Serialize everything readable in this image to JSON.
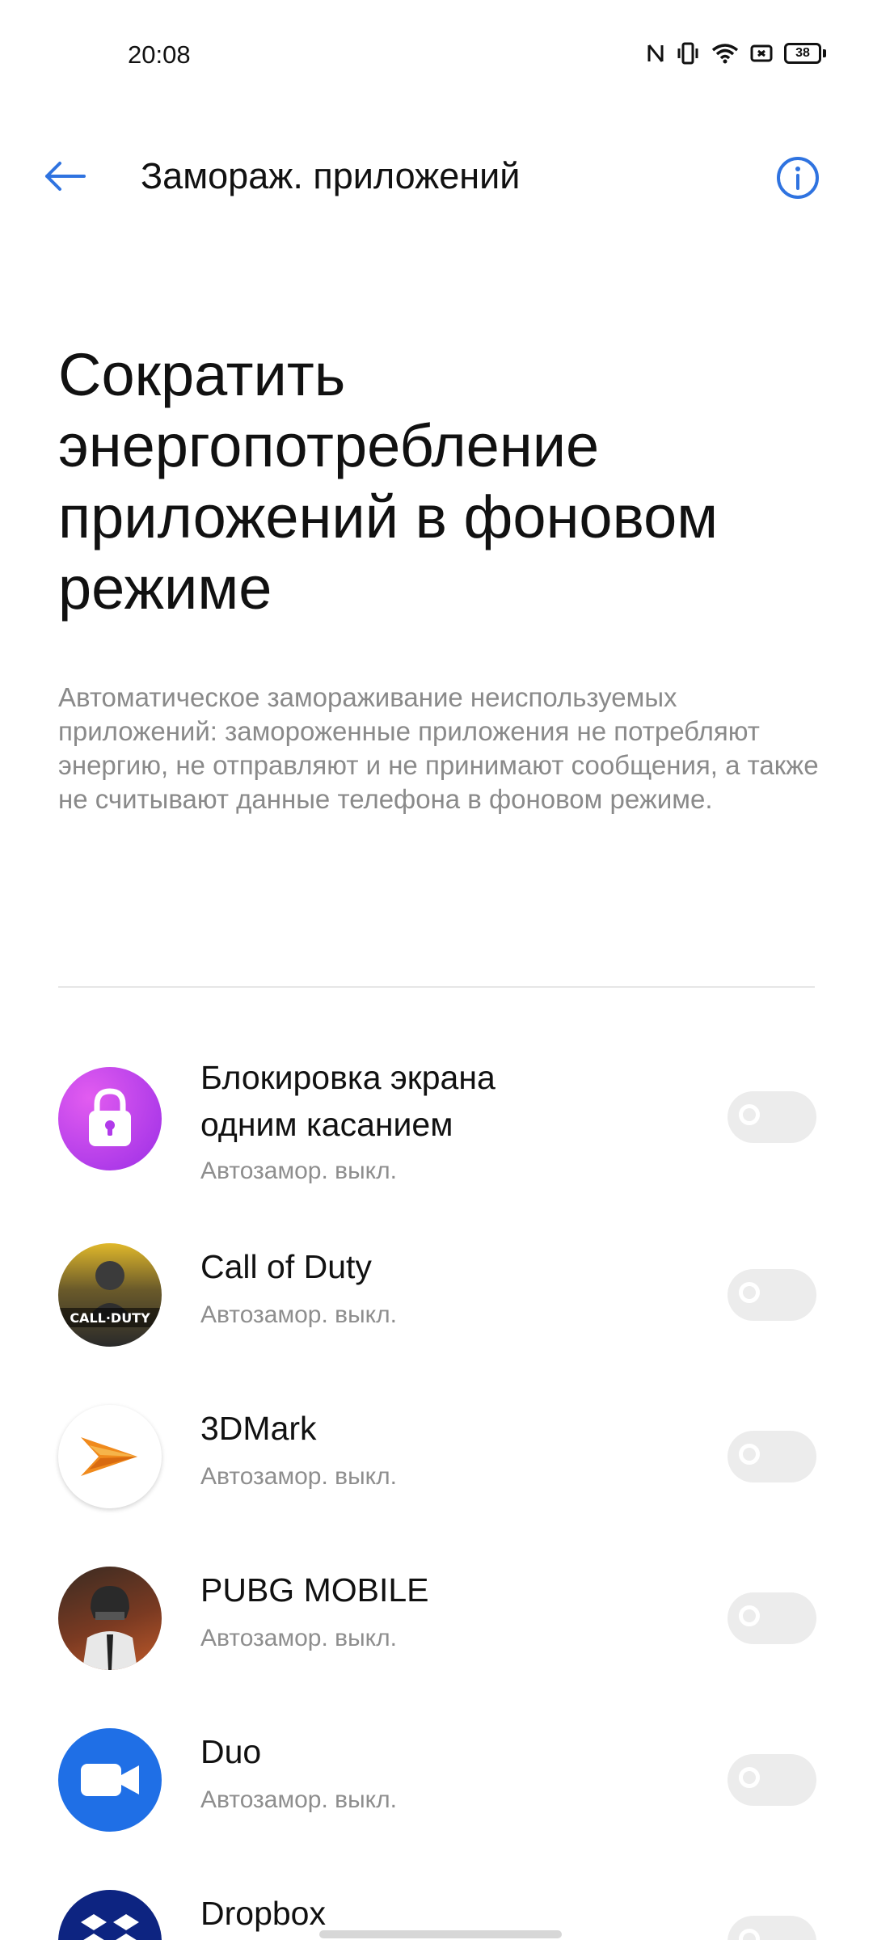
{
  "status_bar": {
    "time": "20:08",
    "battery_level": "38",
    "icons": [
      "nfc-icon",
      "vibrate-icon",
      "wifi-icon",
      "screen-record-icon",
      "battery-icon"
    ]
  },
  "app_bar": {
    "title": "Замораж. приложений",
    "back_icon": "arrow-left-icon",
    "info_icon": "info-icon",
    "accent_color": "#2f73e0"
  },
  "hero": {
    "title": "Сократить энергопотребление приложений в фоновом режиме",
    "description": "Автоматическое замораживание неиспользуемых приложений: замороженные приложения не потребляют энергию, не отправляют и не принимают сообщения, а также не считывают данные телефона в фоновом режиме."
  },
  "apps": [
    {
      "name": "Блокировка экрана одним касанием",
      "status": "Автозамор. выкл.",
      "enabled": false,
      "icon": "lock-icon"
    },
    {
      "name": "Call of Duty",
      "status": "Автозамор. выкл.",
      "enabled": false,
      "icon": "call-of-duty-icon",
      "icon_text": "CALL·DUTY"
    },
    {
      "name": "3DMark",
      "status": "Автозамор. выкл.",
      "enabled": false,
      "icon": "3dmark-icon"
    },
    {
      "name": "PUBG MOBILE",
      "status": "Автозамор. выкл.",
      "enabled": false,
      "icon": "pubg-icon"
    },
    {
      "name": "Duo",
      "status": "Автозамор. выкл.",
      "enabled": false,
      "icon": "video-camera-icon"
    },
    {
      "name": "Dropbox",
      "status": "",
      "enabled": false,
      "icon": "dropbox-icon"
    }
  ]
}
